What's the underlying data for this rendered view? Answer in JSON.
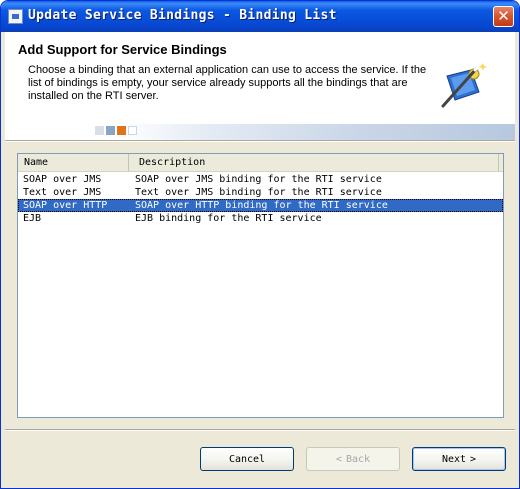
{
  "window": {
    "title": "Update Service Bindings - Binding List",
    "close_glyph": "✕"
  },
  "header": {
    "title": "Add Support for Service Bindings",
    "description": "Choose a binding that an external application can use to access the service. If the list of bindings is empty, your service already supports all the bindings that are installed on the RTI server.",
    "icon": "wizard-puzzle-icon"
  },
  "table": {
    "columns": [
      "Name",
      "Description"
    ],
    "rows": [
      {
        "name": "SOAP over JMS",
        "description": "SOAP over JMS binding for the RTI service",
        "selected": false
      },
      {
        "name": "Text over JMS",
        "description": "Text over JMS binding for the RTI service",
        "selected": false
      },
      {
        "name": "SOAP over HTTP",
        "description": "SOAP over HTTP binding for the RTI service",
        "selected": true
      },
      {
        "name": "EJB",
        "description": "EJB binding for the RTI service",
        "selected": false
      }
    ]
  },
  "buttons": {
    "cancel": "Cancel",
    "back": "Back",
    "back_glyph": "<",
    "next": "Next",
    "next_glyph": ">"
  },
  "colors": {
    "titlebar": "#0747d1",
    "selection": "#316ac5",
    "dialog_bg": "#ece9d8"
  }
}
